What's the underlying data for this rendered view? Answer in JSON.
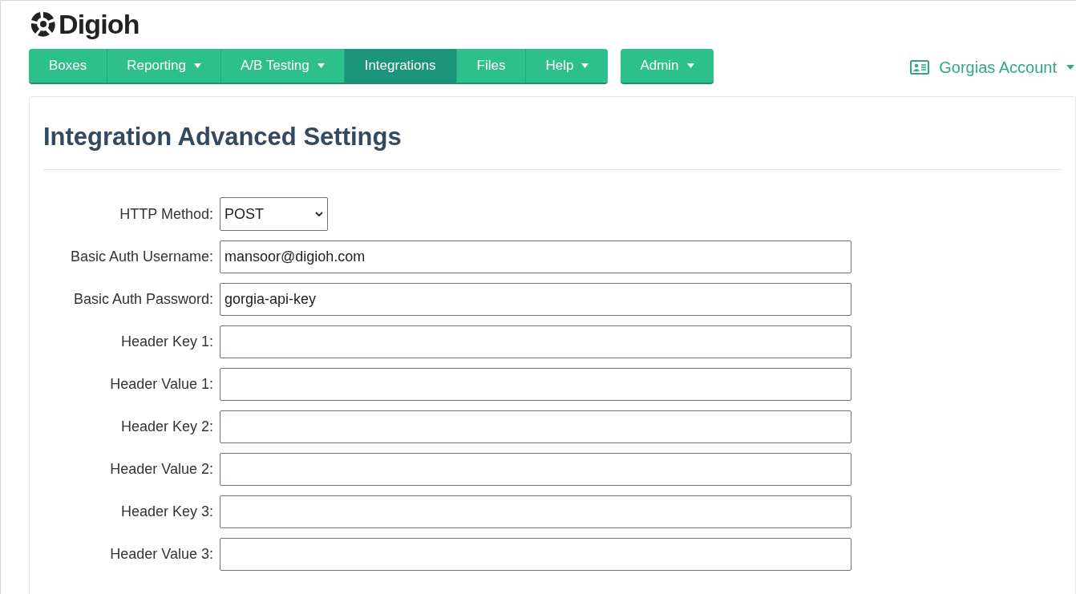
{
  "logo": {
    "text": "Digioh"
  },
  "nav": [
    {
      "label": "Boxes",
      "dropdown": false,
      "selected": false
    },
    {
      "label": "Reporting",
      "dropdown": true,
      "selected": false
    },
    {
      "label": "A/B Testing",
      "dropdown": true,
      "selected": false
    },
    {
      "label": "Integrations",
      "dropdown": false,
      "selected": true
    },
    {
      "label": "Files",
      "dropdown": false,
      "selected": false
    },
    {
      "label": "Help",
      "dropdown": true,
      "selected": false
    }
  ],
  "admin": {
    "label": "Admin",
    "dropdown": true
  },
  "account": {
    "label": "Gorgias Account"
  },
  "page": {
    "title": "Integration Advanced Settings"
  },
  "fields": [
    {
      "kind": "select",
      "label": "HTTP Method:",
      "value": "POST"
    },
    {
      "kind": "text",
      "label": "Basic Auth Username:",
      "value": "mansoor@digioh.com"
    },
    {
      "kind": "text",
      "label": "Basic Auth Password:",
      "value": "gorgia-api-key"
    },
    {
      "kind": "text",
      "label": "Header Key 1:"
    },
    {
      "kind": "text",
      "label": "Header Value 1:"
    },
    {
      "kind": "text",
      "label": "Header Key 2:"
    },
    {
      "kind": "text",
      "label": "Header Value 2:"
    },
    {
      "kind": "text",
      "label": "Header Key 3:"
    },
    {
      "kind": "text",
      "label": "Header Value 3:"
    }
  ]
}
